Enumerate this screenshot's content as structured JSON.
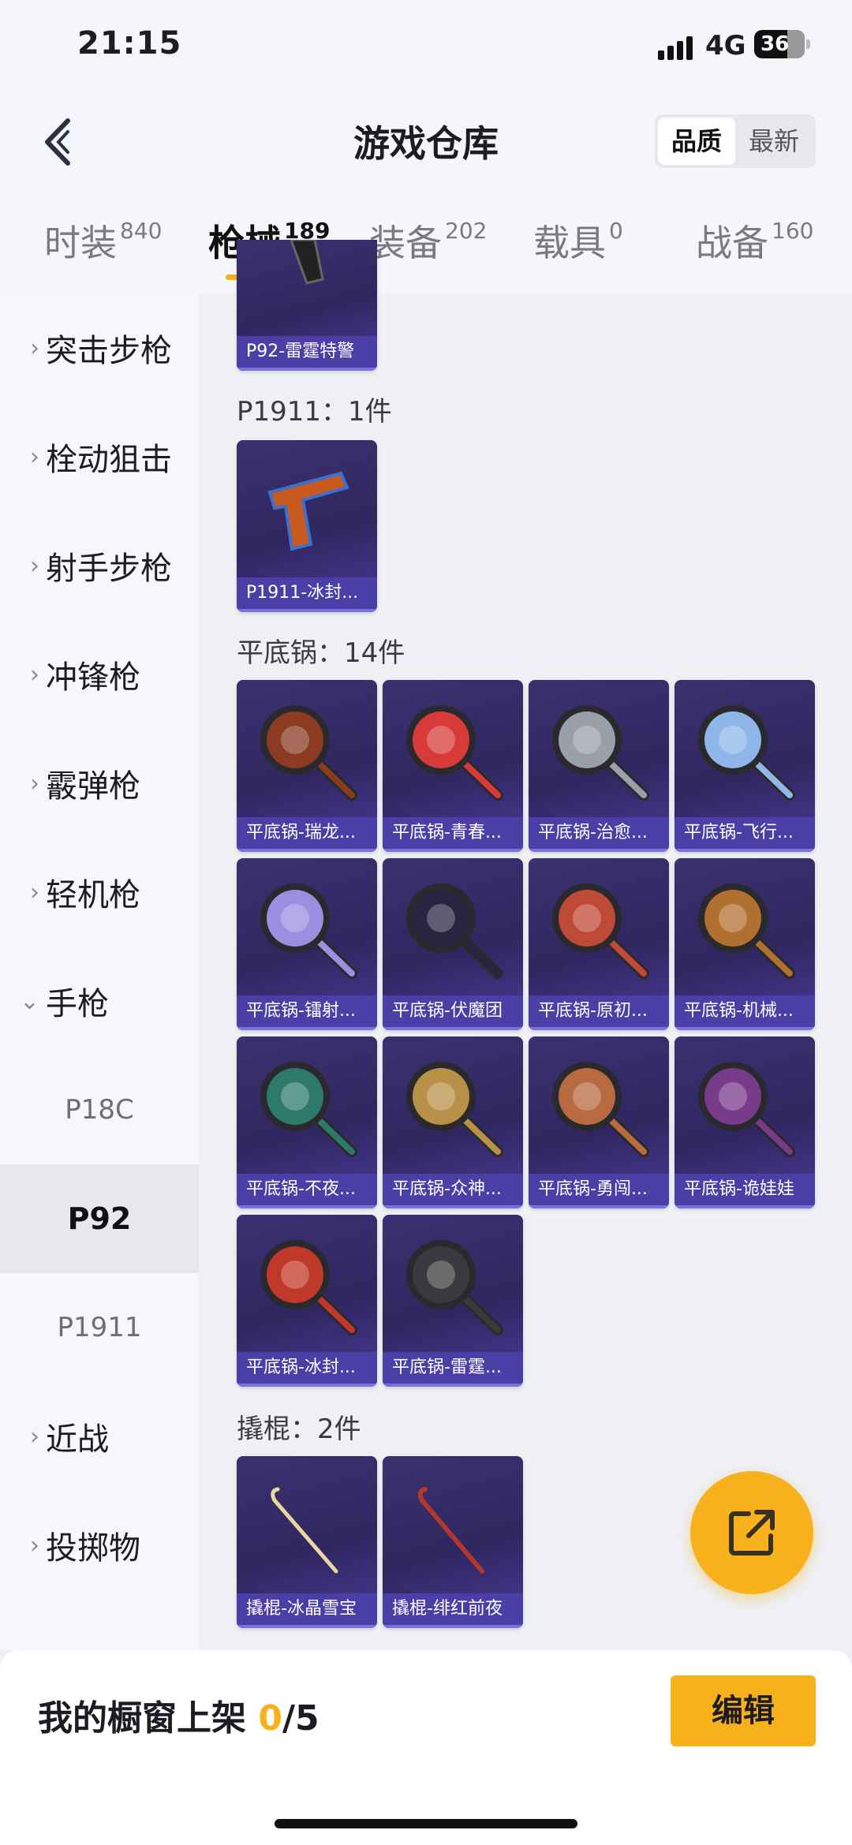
{
  "status": {
    "time": "21:15",
    "network": "4G",
    "battery": "36"
  },
  "header": {
    "title": "游戏仓库",
    "sort": [
      "品质",
      "最新"
    ],
    "sort_active": 0
  },
  "tabs": [
    {
      "label": "时装",
      "count": "840"
    },
    {
      "label": "枪械",
      "count": "189"
    },
    {
      "label": "装备",
      "count": "202"
    },
    {
      "label": "载具",
      "count": "0"
    },
    {
      "label": "战备",
      "count": "160"
    }
  ],
  "sidebar": {
    "categories": [
      "突击步枪",
      "栓动狙击",
      "射手步枪",
      "冲锋枪",
      "霰弹枪",
      "轻机枪",
      "手枪",
      "近战",
      "投掷物"
    ],
    "pistol_subs": [
      "P18C",
      "P92",
      "P1911"
    ],
    "active_sub": "P92"
  },
  "sections": {
    "p92": {
      "items": [
        "P92-雷霆特警"
      ]
    },
    "p1911": {
      "title": "P1911：1件",
      "items": [
        "P1911-冰封..."
      ]
    },
    "pan": {
      "title": "平底锅：14件",
      "items": [
        "平底锅-瑞龙...",
        "平底锅-青春...",
        "平底锅-治愈...",
        "平底锅-飞行...",
        "平底锅-镭射...",
        "平底锅-伏魔团",
        "平底锅-原初...",
        "平底锅-机械...",
        "平底锅-不夜...",
        "平底锅-众神...",
        "平底锅-勇闯...",
        "平底锅-诡娃娃",
        "平底锅-冰封...",
        "平底锅-雷霆..."
      ]
    },
    "crowbar": {
      "title": "撬棍：2件",
      "items": [
        "撬棍-冰晶雪宝",
        "撬棍-绯红前夜"
      ]
    }
  },
  "pan_colors": [
    "#8a3b22",
    "#d83a3a",
    "#9aa0aa",
    "#8fb6e8",
    "#9a8fe0",
    "#2a2440",
    "#c04a38",
    "#b07030",
    "#2e7a6a",
    "#b89048",
    "#b86a40",
    "#7a3a8a",
    "#c03828",
    "#3a3a3e"
  ],
  "bottom": {
    "prefix": "我的橱窗上架 ",
    "count": "0",
    "total": "/5",
    "edit": "编辑"
  }
}
